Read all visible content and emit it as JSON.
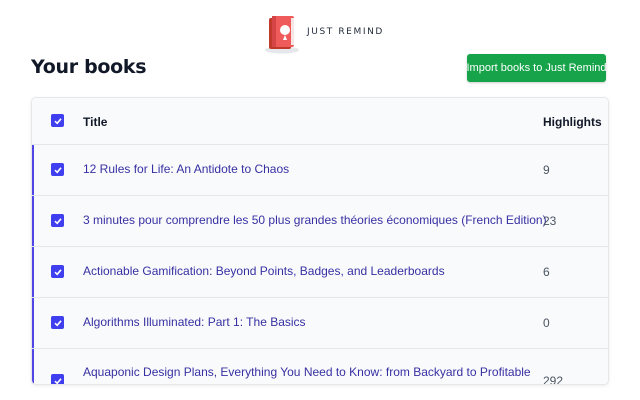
{
  "brand": {
    "name": "JUST REMIND"
  },
  "page": {
    "title": "Your books"
  },
  "actions": {
    "import_label": "Import books to Just Remind"
  },
  "colors": {
    "accent": "#3f3ff0",
    "button": "#16a34a",
    "link": "#3730a3"
  },
  "table": {
    "columns": {
      "title": "Title",
      "highlights": "Highlights"
    },
    "header_checked": true,
    "rows": [
      {
        "title": "12 Rules for Life: An Antidote to Chaos",
        "highlights": "9",
        "checked": true
      },
      {
        "title": "3 minutes pour comprendre les 50 plus grandes théories économiques (French Edition)",
        "highlights": "23",
        "checked": true
      },
      {
        "title": "Actionable Gamification: Beyond Points, Badges, and Leaderboards",
        "highlights": "6",
        "checked": true
      },
      {
        "title": "Algorithms Illuminated: Part 1: The Basics",
        "highlights": "0",
        "checked": true
      },
      {
        "title": "Aquaponic Design Plans, Everything You Need to Know: from Backyard to Profitable",
        "highlights": "292",
        "checked": true
      }
    ]
  }
}
